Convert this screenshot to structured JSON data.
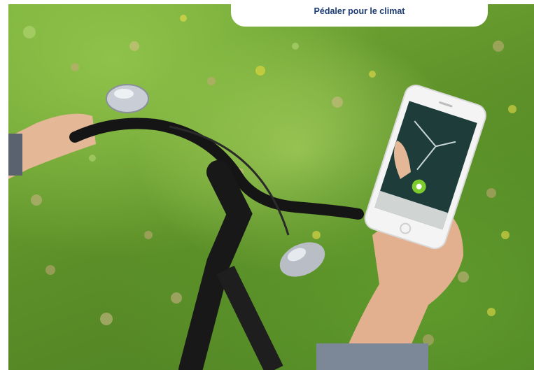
{
  "caption": {
    "text": "Pédaler pour le climat"
  },
  "colors": {
    "caption_text": "#1a3a74",
    "grass": "#6fa534",
    "app_accent": "#7dcc2e",
    "map_bg": "#1e3d3a"
  },
  "icons": [
    "bicycle-bell-icon",
    "smartphone-icon",
    "app-start-button-icon"
  ]
}
